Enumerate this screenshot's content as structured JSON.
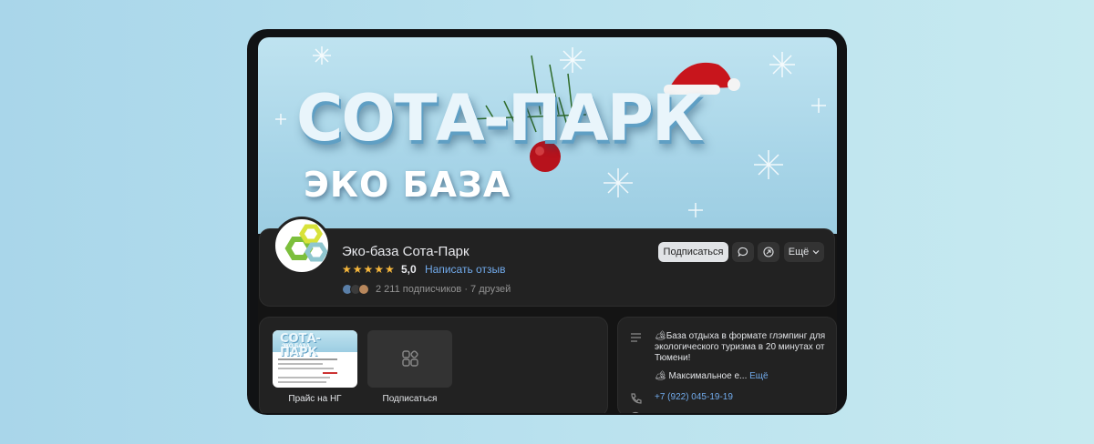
{
  "cover": {
    "title": "СОТА-ПАРК",
    "subtitle": "ЭКО БАЗА"
  },
  "profile": {
    "name": "Эко-база Сота-Парк",
    "stars": "★★★★★",
    "rating": "5,0",
    "review_link": "Написать отзыв",
    "subscribers": "2 211 подписчиков · 7 друзей",
    "subscribe_button": "Подписаться",
    "more_button": "Ещё"
  },
  "widgets": {
    "items": [
      {
        "label": "Прайс на НГ"
      },
      {
        "label": "Подписаться"
      }
    ],
    "thumb_title": "СОТА-ПАРК",
    "thumb_sub": "ЭКО БАЗА"
  },
  "about": {
    "description": "🏕База отдыха в формате глэмпинг для экологического туризма в 20 минутах от Тюмени!",
    "description2": "🏕 Максимальное е...",
    "more_link": "Ещё",
    "phone": "+7 (922) 045-19-19"
  },
  "colors": {
    "accent": "#71aaeb",
    "card": "#222222",
    "star": "#f6b73c"
  }
}
